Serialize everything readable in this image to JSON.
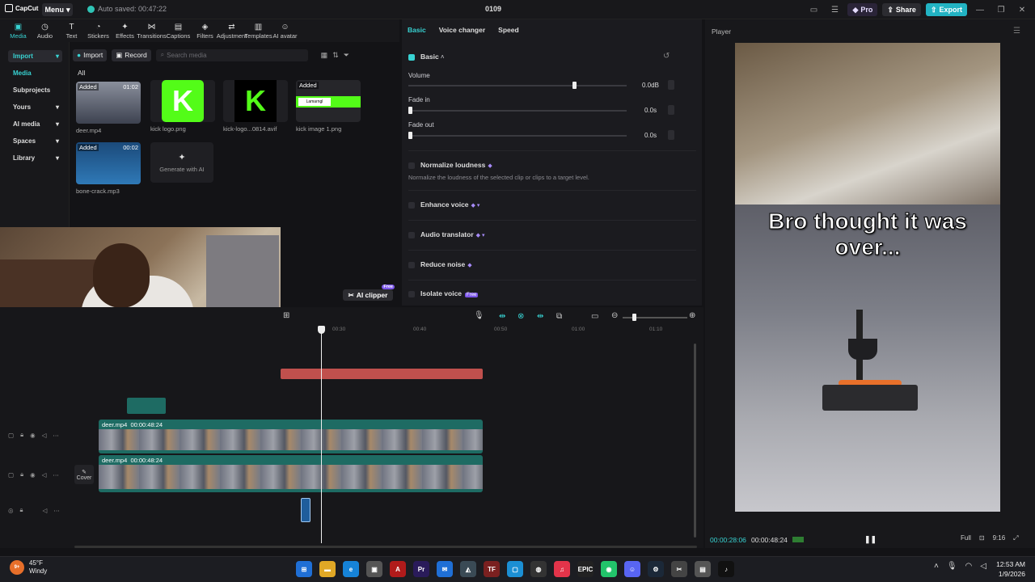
{
  "topbar": {
    "app_name": "CapCut",
    "menu": "Menu",
    "autosave": "Auto saved: 00:47:22",
    "project_title": "0109",
    "pro": "Pro",
    "share": "Share",
    "export": "Export"
  },
  "toolbar": [
    {
      "label": "Media",
      "icon": "▣"
    },
    {
      "label": "Audio",
      "icon": "◷"
    },
    {
      "label": "Text",
      "icon": "T"
    },
    {
      "label": "Stickers",
      "icon": "◔"
    },
    {
      "label": "Effects",
      "icon": "✦"
    },
    {
      "label": "Transitions",
      "icon": "⋈"
    },
    {
      "label": "Captions",
      "icon": "▤"
    },
    {
      "label": "Filters",
      "icon": "◈"
    },
    {
      "label": "Adjustment",
      "icon": "⇄"
    },
    {
      "label": "Templates",
      "icon": "▥"
    },
    {
      "label": "AI avatar",
      "icon": "☺"
    }
  ],
  "leftnav": {
    "import": "Import",
    "media": "Media",
    "subprojects": "Subprojects",
    "yours": "Yours",
    "ai_media": "AI media",
    "spaces": "Spaces",
    "library": "Library"
  },
  "media": {
    "import_btn": "Import",
    "record_btn": "Record",
    "search_placeholder": "Search media",
    "all": "All",
    "items": [
      {
        "name": "deer.mp4",
        "tag": "Added",
        "duration": "01:02"
      },
      {
        "name": "kick logo.png",
        "tag": "",
        "duration": ""
      },
      {
        "name": "kick-logo...0814.avif",
        "tag": "",
        "duration": ""
      },
      {
        "name": "kick image 1.png",
        "tag": "Added",
        "duration": ""
      },
      {
        "name": "bone-crack.mp3",
        "tag": "Added",
        "duration": "00:02"
      }
    ],
    "gen_ai": "Generate with AI",
    "ai_clipper": "AI clipper",
    "free": "Free",
    "kick_banner": "Lamarngl"
  },
  "props": {
    "tabs": [
      "Basic",
      "Voice changer",
      "Speed"
    ],
    "section": "Basic",
    "volume_label": "Volume",
    "volume_value": "0.0dB",
    "volume_level": 0.75,
    "fade_in_label": "Fade in",
    "fade_in_value": "0.0s",
    "fade_out_label": "Fade out",
    "fade_out_value": "0.0s",
    "normalize": "Normalize loudness",
    "normalize_desc": "Normalize the loudness of the selected clip or clips to a target level.",
    "enhance": "Enhance voice",
    "translator": "Audio translator",
    "reduce_noise": "Reduce noise",
    "isolate": "Isolate voice",
    "isolate_tag": "Free"
  },
  "player": {
    "label": "Player",
    "caption": "Bro thought it was over...",
    "time_current": "00:00:28:06",
    "time_total": "00:00:48:24",
    "full": "Full",
    "ratio": "9:16"
  },
  "timeline": {
    "ruler": [
      "00:30",
      "00:40",
      "00:50",
      "01:00",
      "01:10"
    ],
    "clip1_name": "deer.mp4",
    "clip1_dur": "00:00:48:24",
    "clip2_name": "deer.mp4",
    "clip2_dur": "00:00:48:24",
    "cover": "Cover"
  },
  "taskbar": {
    "temp": "45°F",
    "weather": "Windy",
    "time": "12:53 AM",
    "date": "1/9/2026"
  },
  "colors": {
    "accent": "#38d3d3",
    "export": "#22b3c3",
    "clip": "#1e6b63",
    "audio_red": "#c0504d"
  }
}
